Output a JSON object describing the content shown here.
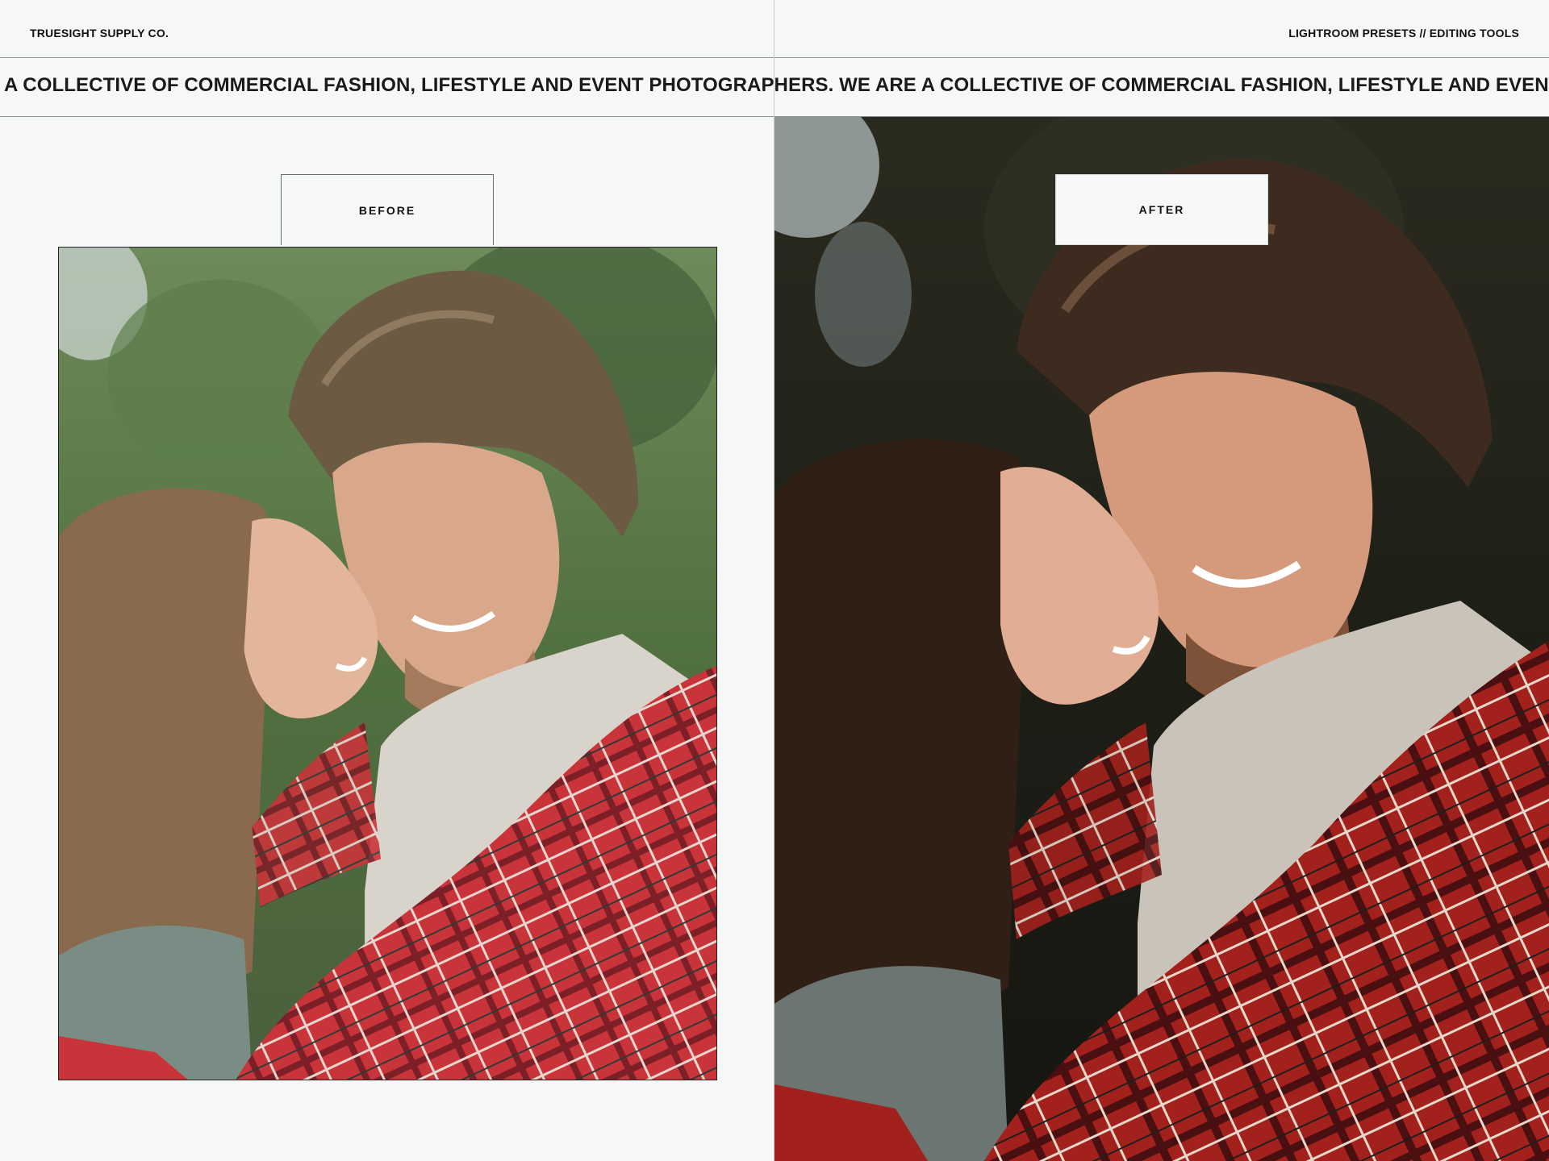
{
  "header": {
    "brand": "TRUESIGHT SUPPLY CO.",
    "tagline": "LIGHTROOM PRESETS // EDITING TOOLS"
  },
  "marquee": {
    "text": "A COLLECTIVE OF COMMERCIAL FASHION, LIFESTYLE AND EVENT PHOTOGRAPHERS. WE ARE A COLLECTIVE OF COMMERCIAL FASHION, LIFESTYLE AND EVENT PHOTOGRAPHERS. WE ARE"
  },
  "comparison": {
    "before_label": "BEFORE",
    "after_label": "AFTER"
  },
  "colors": {
    "background": "#f6f8f7",
    "rule": "#8f9393",
    "text": "#111111"
  }
}
